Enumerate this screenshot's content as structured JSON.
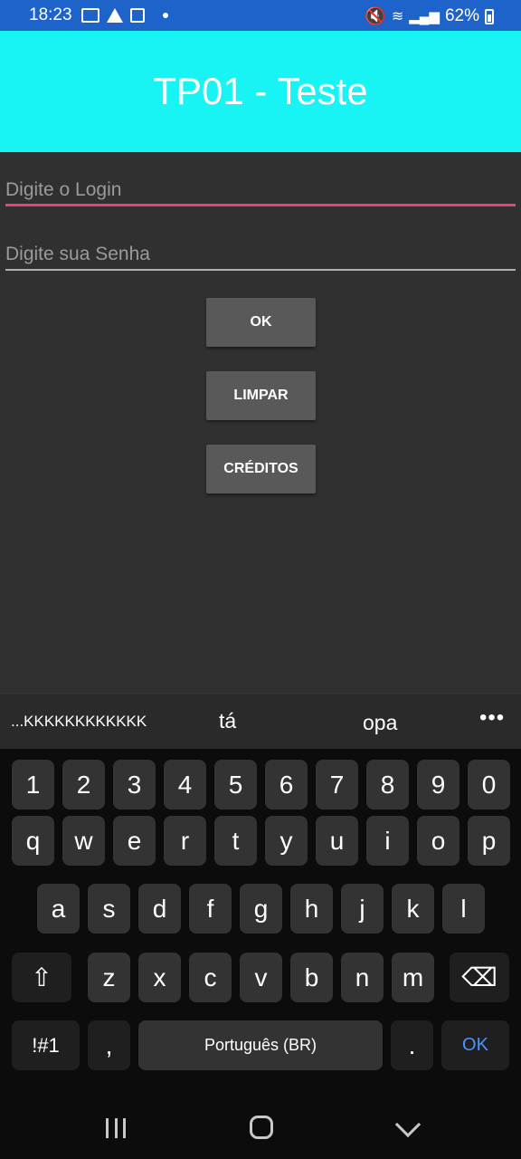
{
  "status_bar": {
    "time": "18:23",
    "battery": "62%"
  },
  "app": {
    "title": "TP01 - Teste"
  },
  "form": {
    "login_placeholder": "Digite o Login",
    "senha_placeholder": "Digite sua Senha",
    "ok_label": "OK",
    "limpar_label": "LIMPAR",
    "creditos_label": "CRÉDITOS"
  },
  "suggestions": [
    "...KKKKKKKKKKKK",
    "tá",
    "opa"
  ],
  "suggestions_more": "•••",
  "keyboard": {
    "row1": [
      "1",
      "2",
      "3",
      "4",
      "5",
      "6",
      "7",
      "8",
      "9",
      "0"
    ],
    "row2": [
      "q",
      "w",
      "e",
      "r",
      "t",
      "y",
      "u",
      "i",
      "o",
      "p"
    ],
    "row3": [
      "a",
      "s",
      "d",
      "f",
      "g",
      "h",
      "j",
      "k",
      "l"
    ],
    "row4": [
      "z",
      "x",
      "c",
      "v",
      "b",
      "n",
      "m"
    ],
    "symbols_label": "!#1",
    "comma_label": ",",
    "space_label": "Português (BR)",
    "period_label": ".",
    "ok_label": "OK",
    "shift_icon": "⇧",
    "backspace_icon": "⌫"
  },
  "colors": {
    "appbar": "#18f4f4",
    "accent": "#e2477a",
    "background": "#303030",
    "status_bar": "#1e63c9"
  }
}
